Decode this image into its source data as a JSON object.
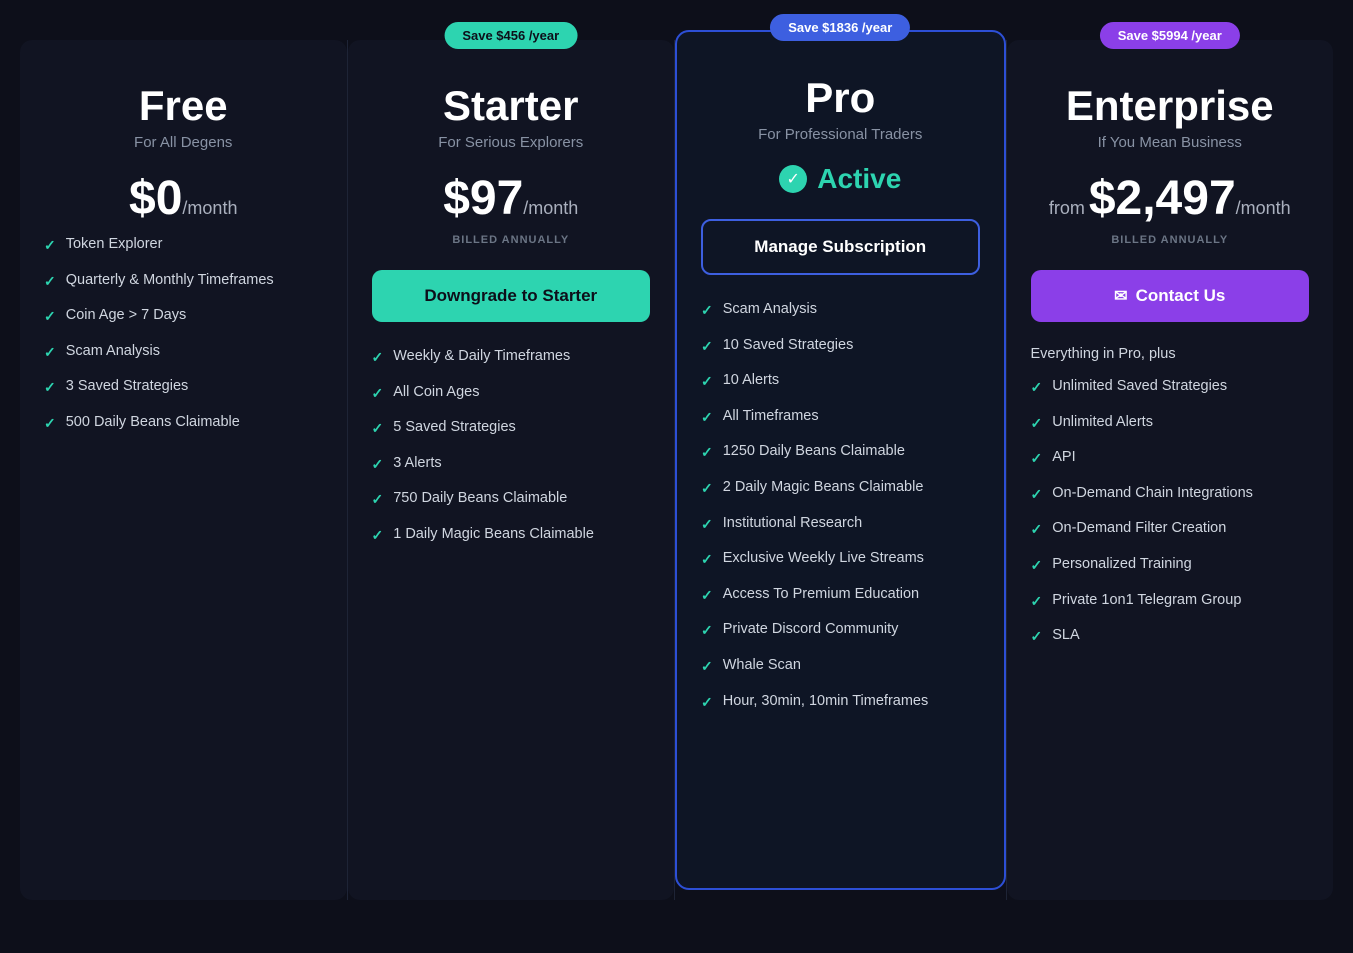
{
  "plans": [
    {
      "id": "free",
      "name": "Free",
      "subtitle": "For All Degens",
      "price": "$0",
      "price_from": "",
      "period": "/month",
      "billing": "",
      "save_badge": null,
      "save_badge_class": "",
      "button_label": null,
      "button_type": null,
      "active": false,
      "features": [
        "Token Explorer",
        "Quarterly & Monthly Timeframes",
        "Coin Age > 7 Days",
        "Scam Analysis",
        "3 Saved Strategies",
        "500 Daily Beans Claimable"
      ],
      "extra_label": null
    },
    {
      "id": "starter",
      "name": "Starter",
      "subtitle": "For Serious Explorers",
      "price": "$97",
      "price_from": "",
      "period": "/month",
      "billing": "BILLED ANNUALLY",
      "save_badge": "Save $456 /year",
      "save_badge_class": "starter",
      "button_label": "Downgrade to Starter",
      "button_type": "downgrade",
      "active": false,
      "features": [
        "Weekly & Daily Timeframes",
        "All Coin Ages",
        "5 Saved Strategies",
        "3 Alerts",
        "750 Daily Beans Claimable",
        "1 Daily Magic Beans Claimable"
      ],
      "extra_label": null
    },
    {
      "id": "pro",
      "name": "Pro",
      "subtitle": "For Professional Traders",
      "price": "",
      "price_from": "",
      "period": "",
      "billing": "",
      "save_badge": "Save $1836 /year",
      "save_badge_class": "pro",
      "button_label": "Manage Subscription",
      "button_type": "manage",
      "active": true,
      "active_label": "Active",
      "features": [
        "Scam Analysis",
        "10 Saved Strategies",
        "10 Alerts",
        "All Timeframes",
        "1250 Daily Beans Claimable",
        "2 Daily Magic Beans Claimable",
        "Institutional Research",
        "Exclusive Weekly Live Streams",
        "Access To Premium Education",
        "Private Discord Community",
        "Whale Scan",
        "Hour, 30min, 10min Timeframes"
      ],
      "extra_label": null
    },
    {
      "id": "enterprise",
      "name": "Enterprise",
      "subtitle": "If You Mean Business",
      "price": "$2,497",
      "price_from": "from",
      "period": "/month",
      "billing": "BILLED ANNUALLY",
      "save_badge": "Save $5994 /year",
      "save_badge_class": "enterprise",
      "button_label": "Contact Us",
      "button_type": "contact",
      "active": false,
      "features": [
        "Unlimited Saved Strategies",
        "Unlimited Alerts",
        "API",
        "On-Demand Chain Integrations",
        "On-Demand Filter Creation",
        "Personalized Training",
        "Private 1on1 Telegram Group",
        "SLA"
      ],
      "extra_label": "Everything in Pro, plus"
    }
  ]
}
